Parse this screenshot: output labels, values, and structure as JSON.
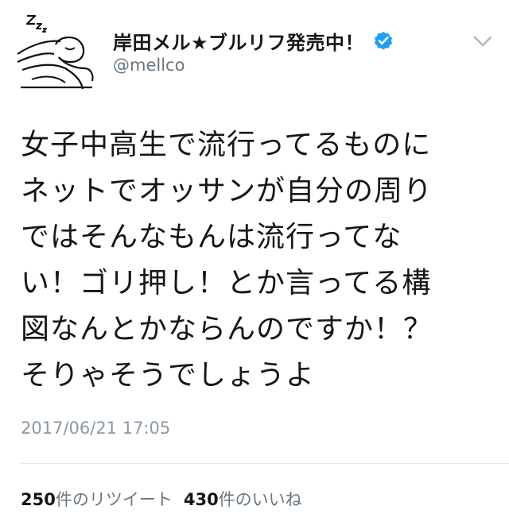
{
  "user": {
    "display_name": "岸田メル★ブルリフ発売中！",
    "handle": "@mellco",
    "avatar_icon": "sleeping-character-avatar",
    "verified_icon": "verified-badge-icon",
    "verified_color": "#1da1f2"
  },
  "menu": {
    "icon": "chevron-down-icon"
  },
  "tweet": {
    "lines": [
      "女子中高生で流行ってるものに",
      "ネットでオッサンが自分の周り",
      "ではそんなもんは流行ってな",
      "い！ゴリ押し！とか言ってる構",
      "図なんとかならんのですか！？",
      "そりゃそうでしょうよ"
    ],
    "timestamp": "2017/06/21 17:05"
  },
  "stats": {
    "retweet_count": "250",
    "retweet_label": "件のリツイート",
    "like_count": "430",
    "like_label": "件のいいね"
  }
}
